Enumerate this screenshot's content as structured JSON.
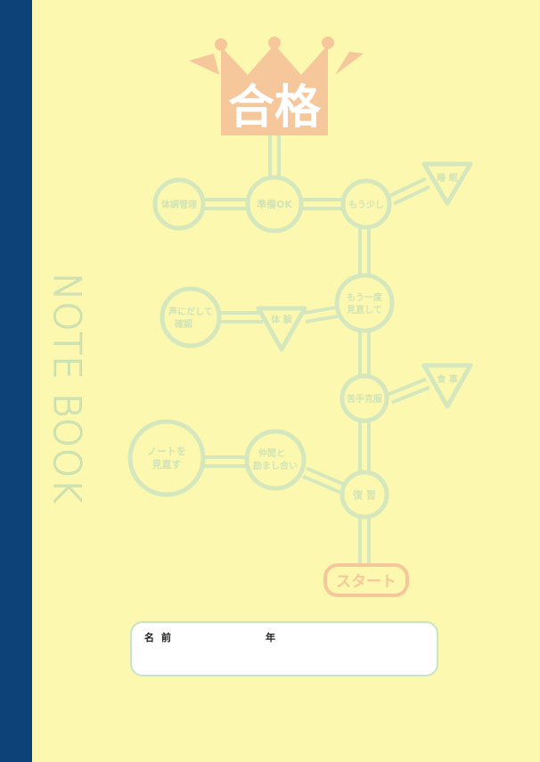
{
  "cover": {
    "title": "NOTE BOOK",
    "crown_text": "合格",
    "start_label": "スタート",
    "nodes": {
      "taichou": "体調管理",
      "junbi": "準備OK",
      "mousukoshi": "もう少し",
      "suimin": "睡 眠",
      "mouichido_1": "もう一度",
      "mouichido_2": "見直して",
      "koe_1": "声にだして",
      "koe_2": "確認",
      "taiken": "体 験",
      "nigate": "苦手克服",
      "shokuji": "食 事",
      "note_1": "ノートを",
      "note_2": "見直す",
      "nakama_1": "仲間と",
      "nakama_2": "励まし合い",
      "fukushu": "復 習"
    },
    "form": {
      "name_label": "名前",
      "year_label": "年"
    },
    "colors": {
      "spine": "#0c4278",
      "cover": "#fdf8b0",
      "path": "#d4e7bd",
      "crown": "#f6c79a"
    }
  }
}
